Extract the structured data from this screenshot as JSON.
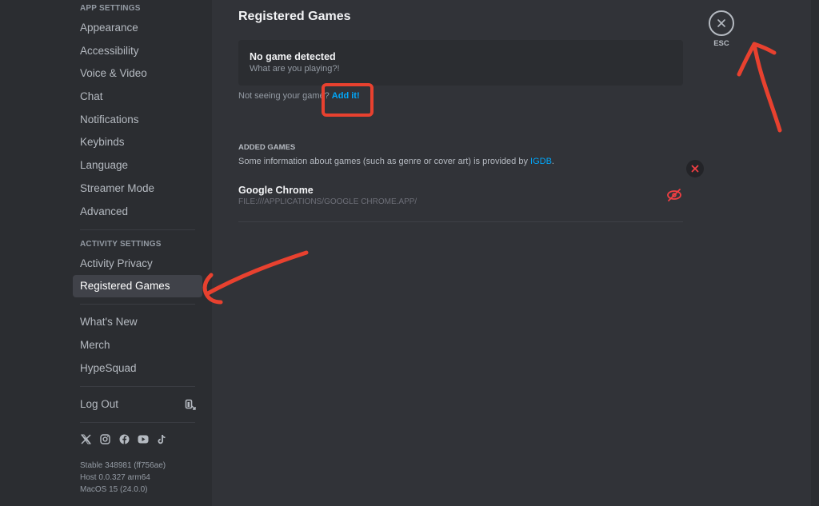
{
  "sidebar": {
    "app_settings_header": "App Settings",
    "app_settings_items": [
      {
        "label": "Appearance"
      },
      {
        "label": "Accessibility"
      },
      {
        "label": "Voice & Video"
      },
      {
        "label": "Chat"
      },
      {
        "label": "Notifications"
      },
      {
        "label": "Keybinds"
      },
      {
        "label": "Language"
      },
      {
        "label": "Streamer Mode"
      },
      {
        "label": "Advanced"
      }
    ],
    "activity_settings_header": "Activity Settings",
    "activity_settings_items": [
      {
        "label": "Activity Privacy"
      },
      {
        "label": "Registered Games",
        "selected": true
      }
    ],
    "misc_items": [
      {
        "label": "What's New"
      },
      {
        "label": "Merch"
      },
      {
        "label": "HypeSquad"
      }
    ],
    "logout_label": "Log Out",
    "social_icons": [
      "x-icon",
      "instagram-icon",
      "facebook-icon",
      "youtube-icon",
      "tiktok-icon"
    ],
    "version": {
      "stable": "Stable 348981 (ff756ae)",
      "host": "Host 0.0.327 arm64",
      "os": "MacOS 15 (24.0.0)"
    }
  },
  "main": {
    "title": "Registered Games",
    "now_playing": {
      "title": "No game detected",
      "subtitle": "What are you playing?!"
    },
    "not_seeing_text": "Not seeing your game?",
    "add_it_label": "Add it!",
    "added_games_header": "Added Games",
    "igdb_info_prefix": "Some information about games (such as genre or cover art) is provided by ",
    "igdb_link": "IGDB",
    "igdb_info_suffix": ".",
    "games": [
      {
        "name": "Google Chrome",
        "path": "FILE:///APPLICATIONS/GOOGLE CHROME.APP/"
      }
    ]
  },
  "close": {
    "esc_label": "ESC"
  },
  "colors": {
    "accent_link": "#00a8fc",
    "danger": "#f23f43",
    "annotation": "#e8412f"
  }
}
